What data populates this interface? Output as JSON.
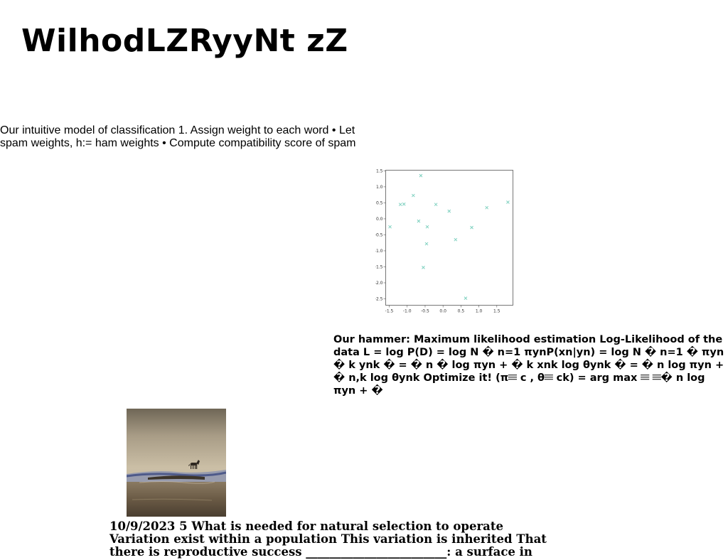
{
  "page": {
    "title": "WilhodLZRyyNt zZ"
  },
  "blocks": {
    "classification_text": "Our intuitive model of classification 1. Assign weight to each word • Let spam weights, h:= ham weights • Compute compatibility score of spam",
    "hammer_text": "Our hammer: Maximum likelihood estimation Log-Likelihood of the data L = log P(D) = log N � n=1 πynP(xn|yn) = log N � n=1 � πyn � k ynk � = � n � log πyn + � k xnk log θynk � = � n log πyn + � n,k log θynk Optimize it! (π𝄘 c , θ𝄘 ck) = arg max 𝄘 𝄘� n log πyn + �",
    "selection_text": "10/9/2023 5 What is needed for natural selection to operate Variation exist within a population This variation is inherited That there is reproductive success ________________________: a surface in"
  },
  "photo": {
    "icon": "wolf-landscape-photo"
  },
  "chart_data": {
    "type": "scatter",
    "title": "",
    "xlabel": "",
    "ylabel": "",
    "xlim": [
      -1.6,
      1.95
    ],
    "ylim": [
      -2.7,
      1.52
    ],
    "xticks": [
      -1.5,
      -1.0,
      -0.5,
      0.0,
      0.5,
      1.0,
      1.5
    ],
    "yticks": [
      1.5,
      1.0,
      0.5,
      0.0,
      -0.5,
      -1.0,
      -1.5,
      -2.0,
      -2.5
    ],
    "xtick_labels": [
      "-1.5",
      "-1.0",
      "-0.5",
      "0.0",
      "0.5",
      "1.0",
      "1.5"
    ],
    "ytick_labels": [
      "1.5",
      "1.0",
      "0.5",
      "0.0",
      "-0.5",
      "-1.0",
      "-1.5",
      "-2.0",
      "-2.5"
    ],
    "grid": false,
    "marker": "x",
    "color": "#7fd1c0",
    "points": [
      {
        "x": -1.48,
        "y": -0.25
      },
      {
        "x": -1.19,
        "y": 0.45
      },
      {
        "x": -1.09,
        "y": 0.46
      },
      {
        "x": -0.83,
        "y": 0.73
      },
      {
        "x": -0.68,
        "y": -0.07
      },
      {
        "x": -0.62,
        "y": 1.35
      },
      {
        "x": -0.55,
        "y": -1.52
      },
      {
        "x": -0.46,
        "y": -0.78
      },
      {
        "x": -0.44,
        "y": -0.25
      },
      {
        "x": -0.2,
        "y": 0.45
      },
      {
        "x": 0.17,
        "y": 0.24
      },
      {
        "x": 0.35,
        "y": -0.65
      },
      {
        "x": 0.63,
        "y": -2.48
      },
      {
        "x": 0.8,
        "y": -0.27
      },
      {
        "x": 1.22,
        "y": 0.35
      },
      {
        "x": 1.81,
        "y": 0.52
      }
    ]
  }
}
